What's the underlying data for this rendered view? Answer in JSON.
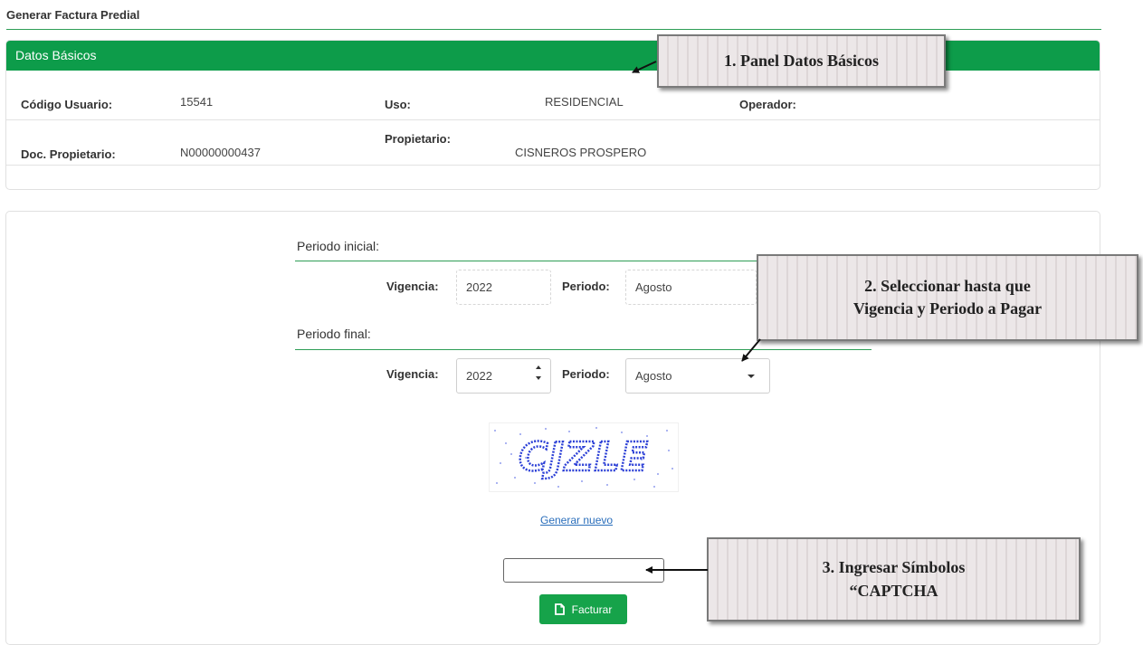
{
  "page": {
    "title": "Generar Factura Predial"
  },
  "basic_panel": {
    "header": "Datos Básicos",
    "fields": {
      "codigo_label": "Código Usuario:",
      "codigo_value": "15541",
      "uso_label": "Uso:",
      "uso_value": "RESIDENCIAL",
      "operador_label": "Operador:",
      "doc_label": "Doc. Propietario:",
      "doc_value": "N00000000437",
      "propietario_label": "Propietario:",
      "propietario_value": "CISNEROS  PROSPERO"
    }
  },
  "form": {
    "initial_label": "Periodo inicial:",
    "final_label": "Periodo final:",
    "vigencia_label": "Vigencia:",
    "periodo_label": "Periodo:",
    "initial_vigencia": "2022",
    "initial_periodo": "Agosto",
    "final_vigencia": "2022",
    "final_periodo": "Agosto",
    "captcha_text": "CJZLE",
    "generate_new": "Generar nuevo",
    "captcha_value": "",
    "submit_label": "Facturar"
  },
  "callouts": {
    "c1": "1. Panel Datos Básicos",
    "c2_line1": "2. Seleccionar hasta que",
    "c2_line2": "Vigencia y Periodo a Pagar",
    "c3_line1": "3. Ingresar Símbolos",
    "c3_line2": "“CAPTCHA"
  },
  "colors": {
    "header_green": "#0d9c4a",
    "rule_green": "#2e9e56",
    "button_green": "#16a34a",
    "link_blue": "#2a6ebb",
    "captcha_blue": "#2b3fd6"
  }
}
